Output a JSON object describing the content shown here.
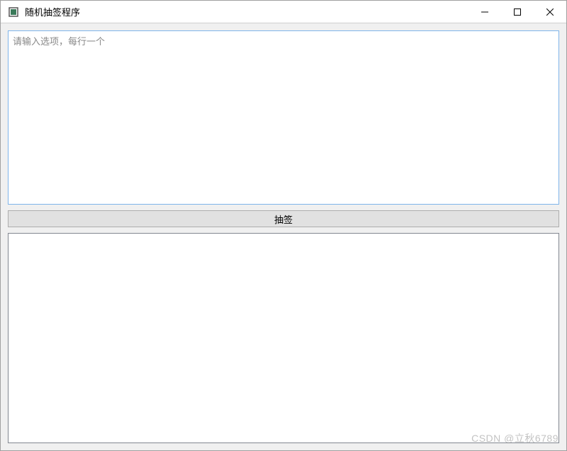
{
  "window": {
    "title": "随机抽签程序"
  },
  "input": {
    "placeholder": "请输入选项，每行一个",
    "value": ""
  },
  "button": {
    "draw_label": "抽签"
  },
  "output": {
    "value": ""
  },
  "watermark": {
    "text": "CSDN @立秋6789"
  }
}
